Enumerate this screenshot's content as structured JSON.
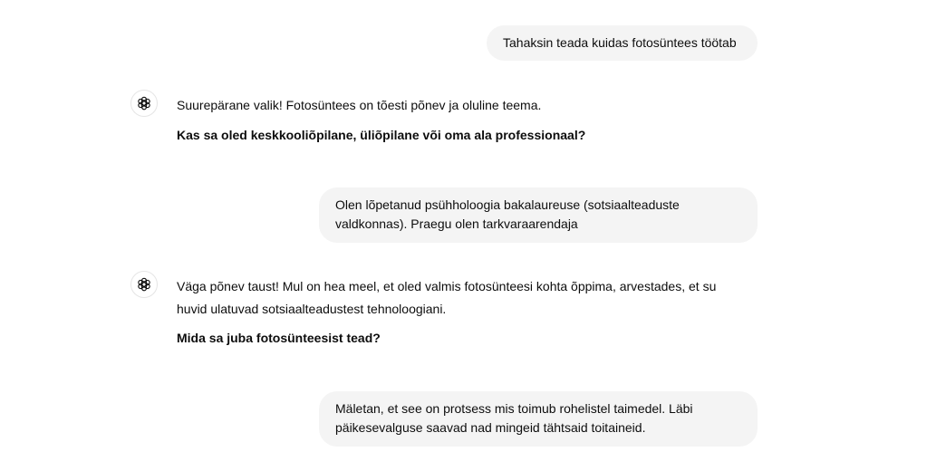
{
  "conversation": {
    "messages": [
      {
        "role": "user",
        "text": "Tahaksin teada kuidas fotosüntees töötab"
      },
      {
        "role": "assistant",
        "icon": "openai-logo-icon",
        "text": "Suurepärane valik! Fotosüntees on tõesti põnev ja oluline teema.",
        "question": "Kas sa oled keskkooliõpilane, üliõpilane või oma ala professionaal?"
      },
      {
        "role": "user",
        "text": "Olen lõpetanud psühholoogia bakalaureuse (sotsiaalteaduste valdkonnas). Praegu olen tarkvaraarendaja"
      },
      {
        "role": "assistant",
        "icon": "openai-logo-icon",
        "text": "Väga põnev taust! Mul on hea meel, et oled valmis fotosünteesi kohta õppima, arvestades, et su huvid ulatuvad sotsiaalteadustest tehnoloogiani.",
        "question": "Mida sa juba fotosünteesist tead?"
      },
      {
        "role": "user",
        "text": "Mäletan, et see on protsess mis toimub rohelistel taimedel. Läbi päikesevalguse saavad nad mingeid tähtsaid toitaineid."
      }
    ]
  }
}
